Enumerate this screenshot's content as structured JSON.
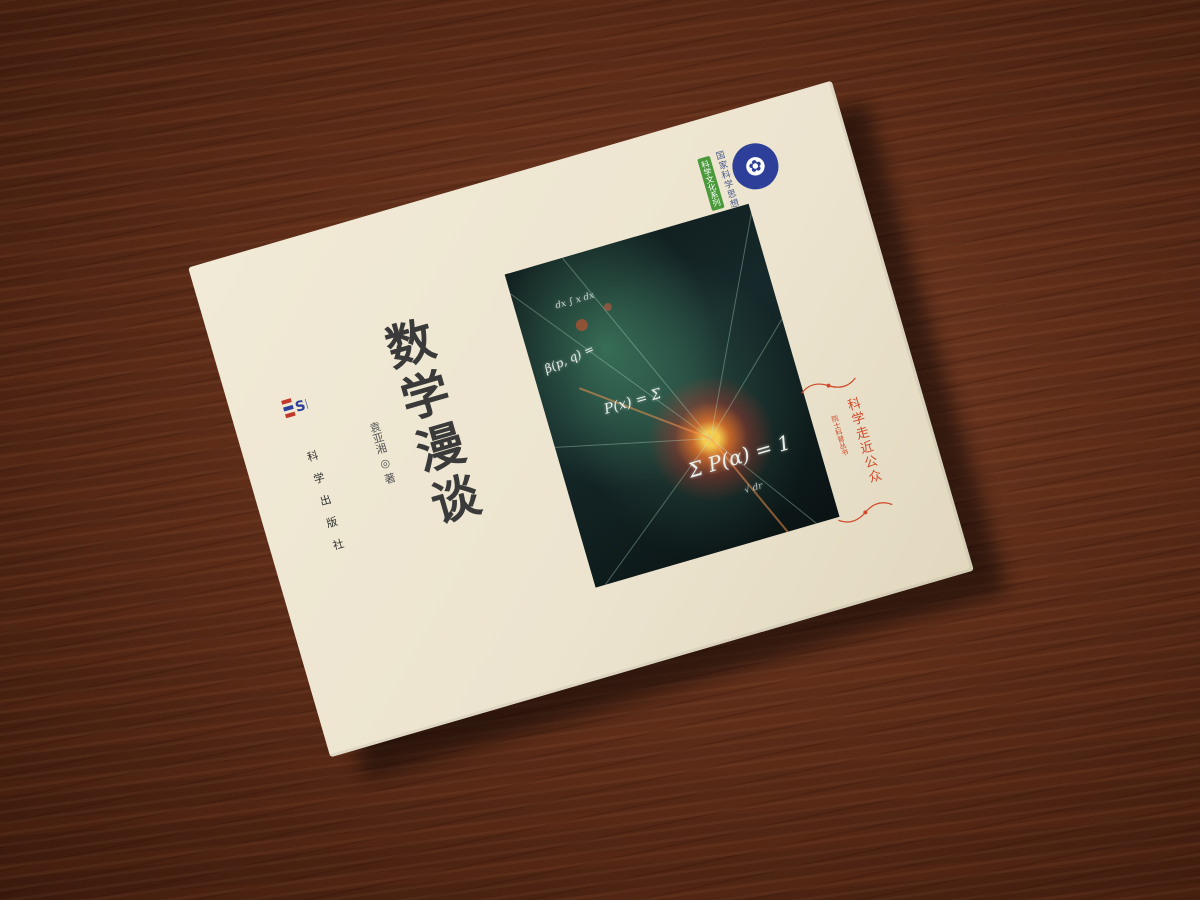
{
  "book": {
    "title": "数学漫谈",
    "author": "袁亚湘 ◎ 著",
    "publisher": "科学出版社",
    "publisher_logo": "SP",
    "series_top": "国家科学思想库",
    "series_top_sub": "科学文化系列",
    "series_badge": "科学走近公众",
    "series_badge_sub": "院士科普丛书"
  },
  "cover_image": {
    "formula_main": "Σ P(α) = 1",
    "formula_2": "P(x) = Σ",
    "formula_3": "β(p, q) =",
    "formula_4": "dx ∫ x dx",
    "formula_5": "√ dr"
  },
  "colors": {
    "cover": "#ece4cf",
    "title": "#3a3a3a",
    "series_badge": "#cf4a2b",
    "logo": "#2d3f98",
    "wood": "#5c2c18"
  }
}
